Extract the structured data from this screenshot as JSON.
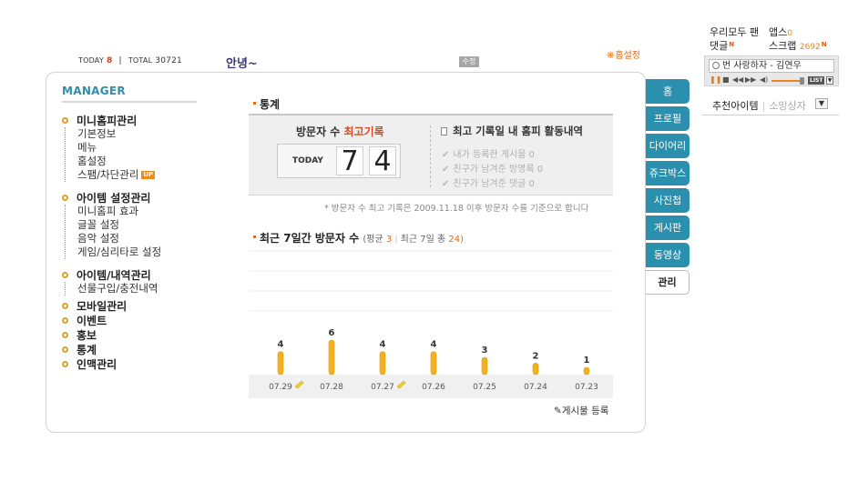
{
  "header": {
    "today_label": "TODAY",
    "today_value": "8",
    "total_label": "TOTAL",
    "total_value": "30721",
    "greeting": "안녕~",
    "edit_label": "수정",
    "home_setting": "홈설정"
  },
  "manager": {
    "title": "MANAGER",
    "groups": [
      {
        "label": "미니홈피관리",
        "items": [
          "기본정보",
          "메뉴",
          "홈설정",
          "스팸/차단관리"
        ],
        "badge": "UP"
      },
      {
        "label": "아이템 설정관리",
        "items": [
          "미니홈피 효과",
          "글꼴 설정",
          "음악 설정",
          "게임/심리타로 설정"
        ]
      },
      {
        "label": "아이템/내역관리",
        "items": [
          "선물구입/충전내역"
        ]
      },
      {
        "label": "모바일관리",
        "items": []
      },
      {
        "label": "이벤트",
        "items": []
      },
      {
        "label": "홍보",
        "items": []
      },
      {
        "label": "통계",
        "items": []
      },
      {
        "label": "인맥관리",
        "items": []
      }
    ]
  },
  "stats": {
    "title": "통계",
    "visitor_label_prefix": "방문자 수",
    "visitor_label_highlight": "최고기록",
    "counter_label": "TODAY",
    "counter_digits": [
      "7",
      "4"
    ],
    "record_title": "최고 기록일 내 홈피 활동내역",
    "record_items": [
      {
        "label": "내가 등록한 게시물",
        "count": "0"
      },
      {
        "label": "친구가 남겨준 방명록",
        "count": "0"
      },
      {
        "label": "친구가 남겨준 댓글",
        "count": "0"
      }
    ],
    "note": "* 방문자 수 최고 기록은 2009.11.18 이후 방문자 수를 기준으로 합니다"
  },
  "week": {
    "title": "최근 7일간 방문자 수",
    "avg_label": "(평균",
    "avg_value": "3",
    "total_label": "최근 7일 총",
    "total_value": "24)",
    "register_label": "게시물 등록"
  },
  "chart_data": {
    "type": "bar",
    "categories": [
      "07.29",
      "07.28",
      "07.27",
      "07.26",
      "07.25",
      "07.24",
      "07.23"
    ],
    "values": [
      4,
      6,
      4,
      4,
      3,
      2,
      1
    ],
    "pencil_marks": [
      true,
      false,
      true,
      false,
      false,
      false,
      false
    ],
    "title": "최근 7일간 방문자 수",
    "ylim": [
      0,
      6
    ],
    "bar_color": "#f3b020"
  },
  "tabs": [
    "홈",
    "프로필",
    "다이어리",
    "쥬크박스",
    "사진첩",
    "게시판",
    "동영상",
    "관리"
  ],
  "active_tab": "관리",
  "right_panel": {
    "fan_label": "우리모두 팬",
    "apps_label": "앱스",
    "apps_count": "0",
    "comment_label": "댓글",
    "scrap_label": "스크랩",
    "scrap_count": "2692",
    "new_badge": "N",
    "song": "번 사랑하자 - 김연우",
    "list_label": "LIST",
    "rec_label": "추천아이템",
    "shop_label": "소망상자"
  },
  "colors": {
    "accent": "#2a90ad",
    "orange": "#e06a10",
    "bar": "#f3b020"
  }
}
